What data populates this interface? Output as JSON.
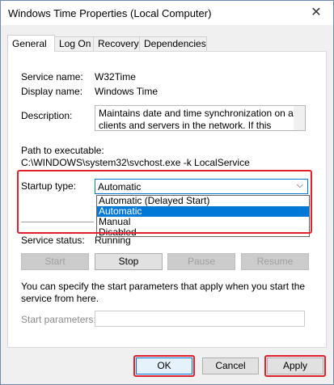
{
  "window": {
    "title": "Windows Time Properties (Local Computer)",
    "close_glyph": "✕"
  },
  "tabs": [
    {
      "label": "General"
    },
    {
      "label": "Log On"
    },
    {
      "label": "Recovery"
    },
    {
      "label": "Dependencies"
    }
  ],
  "general": {
    "service_name_label": "Service name:",
    "service_name_value": "W32Time",
    "display_name_label": "Display name:",
    "display_name_value": "Windows Time",
    "description_label": "Description:",
    "description_value": "Maintains date and time synchronization on all clients and servers in the network. If this service is",
    "path_label": "Path to executable:",
    "path_value": "C:\\WINDOWS\\system32\\svchost.exe -k LocalService",
    "startup_type_label": "Startup type:",
    "startup_type_value": "Automatic",
    "startup_options": [
      "Automatic (Delayed Start)",
      "Automatic",
      "Manual",
      "Disabled"
    ],
    "service_status_label": "Service status:",
    "service_status_value": "Running",
    "start_label": "Start",
    "stop_label": "Stop",
    "pause_label": "Pause",
    "resume_label": "Resume",
    "hint": "You can specify the start parameters that apply when you start the service from here.",
    "start_params_label": "Start parameters:",
    "start_params_value": ""
  },
  "footer": {
    "ok_label": "OK",
    "cancel_label": "Cancel",
    "apply_label": "Apply"
  },
  "colors": {
    "highlight": "#e0202a",
    "selection": "#0078d7"
  }
}
